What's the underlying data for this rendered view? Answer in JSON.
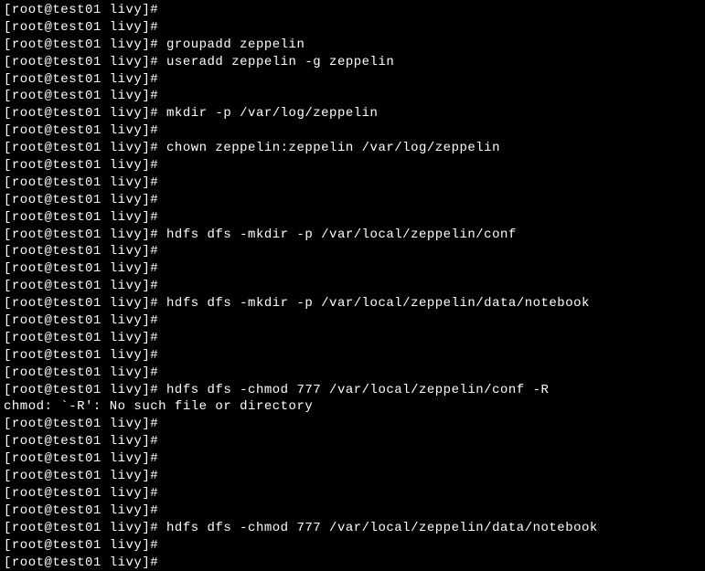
{
  "terminal": {
    "lines": [
      "[root@test01 livy]#",
      "[root@test01 livy]#",
      "[root@test01 livy]# groupadd zeppelin",
      "[root@test01 livy]# useradd zeppelin -g zeppelin",
      "[root@test01 livy]#",
      "[root@test01 livy]#",
      "[root@test01 livy]# mkdir -p /var/log/zeppelin",
      "[root@test01 livy]#",
      "[root@test01 livy]# chown zeppelin:zeppelin /var/log/zeppelin",
      "[root@test01 livy]#",
      "[root@test01 livy]#",
      "[root@test01 livy]#",
      "[root@test01 livy]#",
      "[root@test01 livy]# hdfs dfs -mkdir -p /var/local/zeppelin/conf",
      "[root@test01 livy]#",
      "[root@test01 livy]#",
      "[root@test01 livy]#",
      "[root@test01 livy]# hdfs dfs -mkdir -p /var/local/zeppelin/data/notebook",
      "[root@test01 livy]#",
      "[root@test01 livy]#",
      "[root@test01 livy]#",
      "[root@test01 livy]#",
      "[root@test01 livy]# hdfs dfs -chmod 777 /var/local/zeppelin/conf -R",
      "chmod: `-R': No such file or directory",
      "[root@test01 livy]#",
      "[root@test01 livy]#",
      "[root@test01 livy]#",
      "[root@test01 livy]#",
      "[root@test01 livy]#",
      "[root@test01 livy]#",
      "[root@test01 livy]# hdfs dfs -chmod 777 /var/local/zeppelin/data/notebook",
      "[root@test01 livy]#",
      "[root@test01 livy]#"
    ]
  }
}
